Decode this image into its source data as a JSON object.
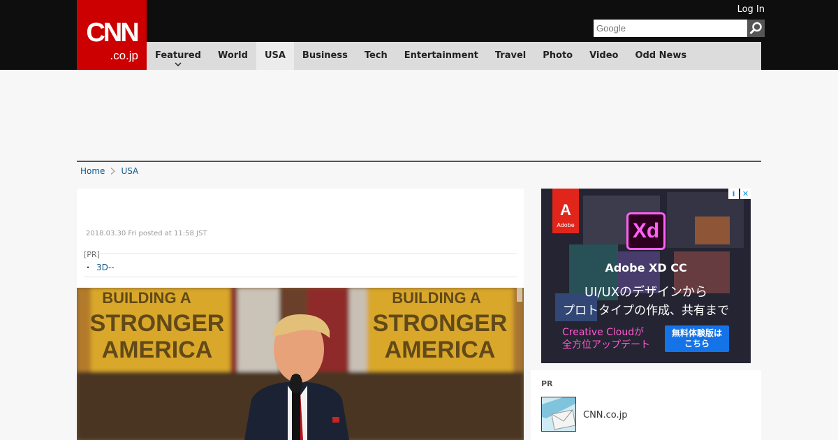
{
  "header": {
    "logo_main": "CNN",
    "logo_sub": ".co.jp",
    "login_label": "Log In",
    "search_placeholder": "Google",
    "accent_color": "#cc0000"
  },
  "nav": {
    "items": [
      {
        "label": "Featured",
        "has_dropdown": true,
        "active": false
      },
      {
        "label": "World",
        "active": false
      },
      {
        "label": "USA",
        "active": true
      },
      {
        "label": "Business",
        "active": false
      },
      {
        "label": "Tech",
        "active": false
      },
      {
        "label": "Entertainment",
        "active": false
      },
      {
        "label": "Travel",
        "active": false
      },
      {
        "label": "Photo",
        "active": false
      },
      {
        "label": "Video",
        "active": false
      },
      {
        "label": "Odd News",
        "active": false
      }
    ]
  },
  "breadcrumb": {
    "home": "Home",
    "current": "USA"
  },
  "article": {
    "date": "2018.03.30 Fri posted at 11:58 JST",
    "pr_label": "[PR]",
    "pr_bullet": "・",
    "pr_link": "3D--",
    "photo_sign_text_left": "BUILDING A STRONGER AMERICA",
    "photo_sign_text_right": "BUILDING A STRONGER AMERICA"
  },
  "ad": {
    "brand_short": "A",
    "brand_name": "Adobe",
    "product_icon": "Xd",
    "product": "Adobe XD CC",
    "line1": "UI/UXのデザインから",
    "line2": "プロトタイプの作成、共有まで",
    "cc_line1": "Creative Cloudが",
    "cc_line2": "全方位アップデート",
    "button_line1": "無料体験版は",
    "button_line2": "こちら",
    "info_icon": "i",
    "close_icon": "✕"
  },
  "pr_box": {
    "title": "PR",
    "item_text": "CNN.co.jp"
  }
}
